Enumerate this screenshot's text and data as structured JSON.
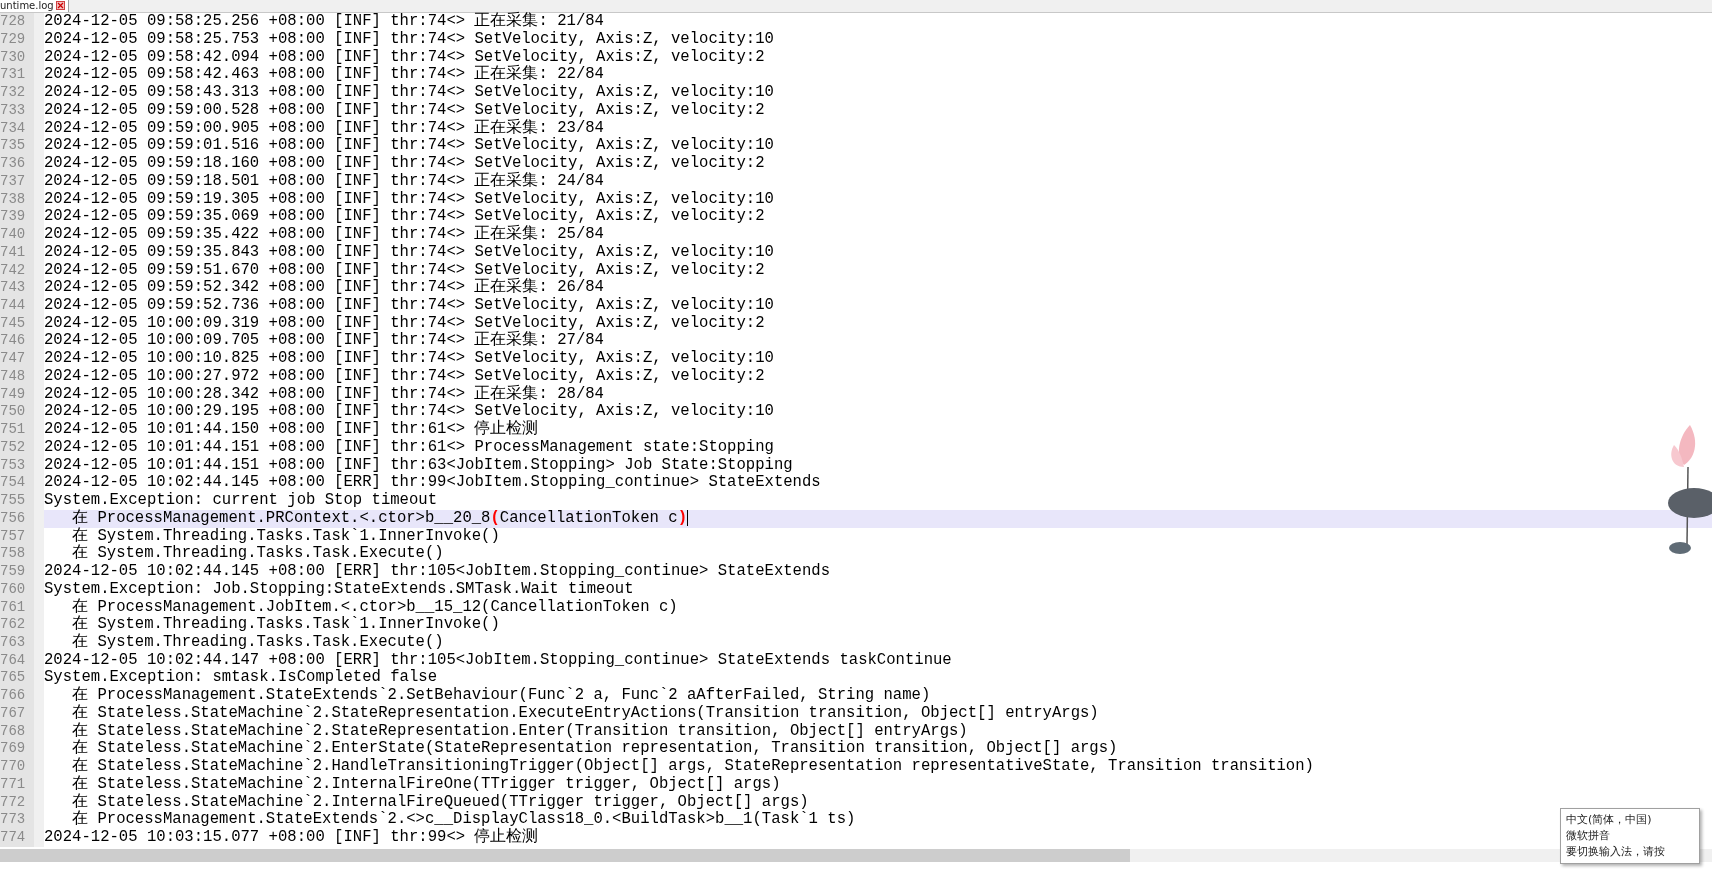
{
  "tab": {
    "label": "untime.log",
    "selected": true
  },
  "lines": [
    {
      "number": "728",
      "text": "2024-12-05 09:58:25.256 +08:00 [INF] thr:74<> 正在采集: 21/84",
      "selected": false
    },
    {
      "number": "729",
      "text": "2024-12-05 09:58:25.753 +08:00 [INF] thr:74<> SetVelocity, Axis:Z, velocity:10",
      "selected": false
    },
    {
      "number": "730",
      "text": "2024-12-05 09:58:42.094 +08:00 [INF] thr:74<> SetVelocity, Axis:Z, velocity:2",
      "selected": false
    },
    {
      "number": "731",
      "text": "2024-12-05 09:58:42.463 +08:00 [INF] thr:74<> 正在采集: 22/84",
      "selected": false
    },
    {
      "number": "732",
      "text": "2024-12-05 09:58:43.313 +08:00 [INF] thr:74<> SetVelocity, Axis:Z, velocity:10",
      "selected": false
    },
    {
      "number": "733",
      "text": "2024-12-05 09:59:00.528 +08:00 [INF] thr:74<> SetVelocity, Axis:Z, velocity:2",
      "selected": false
    },
    {
      "number": "734",
      "text": "2024-12-05 09:59:00.905 +08:00 [INF] thr:74<> 正在采集: 23/84",
      "selected": false
    },
    {
      "number": "735",
      "text": "2024-12-05 09:59:01.516 +08:00 [INF] thr:74<> SetVelocity, Axis:Z, velocity:10",
      "selected": false
    },
    {
      "number": "736",
      "text": "2024-12-05 09:59:18.160 +08:00 [INF] thr:74<> SetVelocity, Axis:Z, velocity:2",
      "selected": false
    },
    {
      "number": "737",
      "text": "2024-12-05 09:59:18.501 +08:00 [INF] thr:74<> 正在采集: 24/84",
      "selected": false
    },
    {
      "number": "738",
      "text": "2024-12-05 09:59:19.305 +08:00 [INF] thr:74<> SetVelocity, Axis:Z, velocity:10",
      "selected": false
    },
    {
      "number": "739",
      "text": "2024-12-05 09:59:35.069 +08:00 [INF] thr:74<> SetVelocity, Axis:Z, velocity:2",
      "selected": false
    },
    {
      "number": "740",
      "text": "2024-12-05 09:59:35.422 +08:00 [INF] thr:74<> 正在采集: 25/84",
      "selected": false
    },
    {
      "number": "741",
      "text": "2024-12-05 09:59:35.843 +08:00 [INF] thr:74<> SetVelocity, Axis:Z, velocity:10",
      "selected": false
    },
    {
      "number": "742",
      "text": "2024-12-05 09:59:51.670 +08:00 [INF] thr:74<> SetVelocity, Axis:Z, velocity:2",
      "selected": false
    },
    {
      "number": "743",
      "text": "2024-12-05 09:59:52.342 +08:00 [INF] thr:74<> 正在采集: 26/84",
      "selected": false
    },
    {
      "number": "744",
      "text": "2024-12-05 09:59:52.736 +08:00 [INF] thr:74<> SetVelocity, Axis:Z, velocity:10",
      "selected": false
    },
    {
      "number": "745",
      "text": "2024-12-05 10:00:09.319 +08:00 [INF] thr:74<> SetVelocity, Axis:Z, velocity:2",
      "selected": false
    },
    {
      "number": "746",
      "text": "2024-12-05 10:00:09.705 +08:00 [INF] thr:74<> 正在采集: 27/84",
      "selected": false
    },
    {
      "number": "747",
      "text": "2024-12-05 10:00:10.825 +08:00 [INF] thr:74<> SetVelocity, Axis:Z, velocity:10",
      "selected": false
    },
    {
      "number": "748",
      "text": "2024-12-05 10:00:27.972 +08:00 [INF] thr:74<> SetVelocity, Axis:Z, velocity:2",
      "selected": false
    },
    {
      "number": "749",
      "text": "2024-12-05 10:00:28.342 +08:00 [INF] thr:74<> 正在采集: 28/84",
      "selected": false
    },
    {
      "number": "750",
      "text": "2024-12-05 10:00:29.195 +08:00 [INF] thr:74<> SetVelocity, Axis:Z, velocity:10",
      "selected": false
    },
    {
      "number": "751",
      "text": "2024-12-05 10:01:44.150 +08:00 [INF] thr:61<> 停止检测",
      "selected": false
    },
    {
      "number": "752",
      "text": "2024-12-05 10:01:44.151 +08:00 [INF] thr:61<> ProcessManagement state:Stopping",
      "selected": false
    },
    {
      "number": "753",
      "text": "2024-12-05 10:01:44.151 +08:00 [INF] thr:63<JobItem.Stopping> Job State:Stopping",
      "selected": false
    },
    {
      "number": "754",
      "text": "2024-12-05 10:02:44.145 +08:00 [ERR] thr:99<JobItem.Stopping_continue> StateExtends",
      "selected": false
    },
    {
      "number": "755",
      "text": "System.Exception: current job Stop timeout",
      "selected": false
    },
    {
      "number": "756",
      "segments": [
        {
          "kind": "code",
          "text": "   在 ProcessManagement.PRContext.<.ctor>b__20_8"
        },
        {
          "kind": "brace",
          "text": "("
        },
        {
          "kind": "code",
          "text": "CancellationToken c"
        },
        {
          "kind": "brace",
          "text": ")"
        }
      ],
      "selected": true
    },
    {
      "number": "757",
      "text": "   在 System.Threading.Tasks.Task`1.InnerInvoke()",
      "selected": false
    },
    {
      "number": "758",
      "text": "   在 System.Threading.Tasks.Task.Execute()",
      "selected": false
    },
    {
      "number": "759",
      "text": "2024-12-05 10:02:44.145 +08:00 [ERR] thr:105<JobItem.Stopping_continue> StateExtends",
      "selected": false
    },
    {
      "number": "760",
      "text": "System.Exception: Job.Stopping:StateExtends.SMTask.Wait timeout",
      "selected": false
    },
    {
      "number": "761",
      "text": "   在 ProcessManagement.JobItem.<.ctor>b__15_12(CancellationToken c)",
      "selected": false
    },
    {
      "number": "762",
      "text": "   在 System.Threading.Tasks.Task`1.InnerInvoke()",
      "selected": false
    },
    {
      "number": "763",
      "text": "   在 System.Threading.Tasks.Task.Execute()",
      "selected": false
    },
    {
      "number": "764",
      "text": "2024-12-05 10:02:44.147 +08:00 [ERR] thr:105<JobItem.Stopping_continue> StateExtends taskContinue",
      "selected": false
    },
    {
      "number": "765",
      "text": "System.Exception: smtask.IsCompleted false",
      "selected": false
    },
    {
      "number": "766",
      "text": "   在 ProcessManagement.StateExtends`2.SetBehaviour(Func`2 a, Func`2 aAfterFailed, String name)",
      "selected": false
    },
    {
      "number": "767",
      "text": "   在 Stateless.StateMachine`2.StateRepresentation.ExecuteEntryActions(Transition transition, Object[] entryArgs)",
      "selected": false
    },
    {
      "number": "768",
      "text": "   在 Stateless.StateMachine`2.StateRepresentation.Enter(Transition transition, Object[] entryArgs)",
      "selected": false
    },
    {
      "number": "769",
      "text": "   在 Stateless.StateMachine`2.EnterState(StateRepresentation representation, Transition transition, Object[] args)",
      "selected": false
    },
    {
      "number": "770",
      "text": "   在 Stateless.StateMachine`2.HandleTransitioningTrigger(Object[] args, StateRepresentation representativeState, Transition transition)",
      "selected": false
    },
    {
      "number": "771",
      "text": "   在 Stateless.StateMachine`2.InternalFireOne(TTrigger trigger, Object[] args)",
      "selected": false
    },
    {
      "number": "772",
      "text": "   在 Stateless.StateMachine`2.InternalFireQueued(TTrigger trigger, Object[] args)",
      "selected": false
    },
    {
      "number": "773",
      "text": "   在 ProcessManagement.StateExtends`2.<>c__DisplayClass18_0.<BuildTask>b__1(Task`1 ts)",
      "selected": false
    },
    {
      "number": "774",
      "text": "2024-12-05 10:03:15.077 +08:00 [INF] thr:99<> 停止检测",
      "selected": false
    }
  ],
  "ime_popup": {
    "lines": [
      "中文(简体，中国)",
      "微软拼音",
      "要切换输入法，请按"
    ]
  }
}
